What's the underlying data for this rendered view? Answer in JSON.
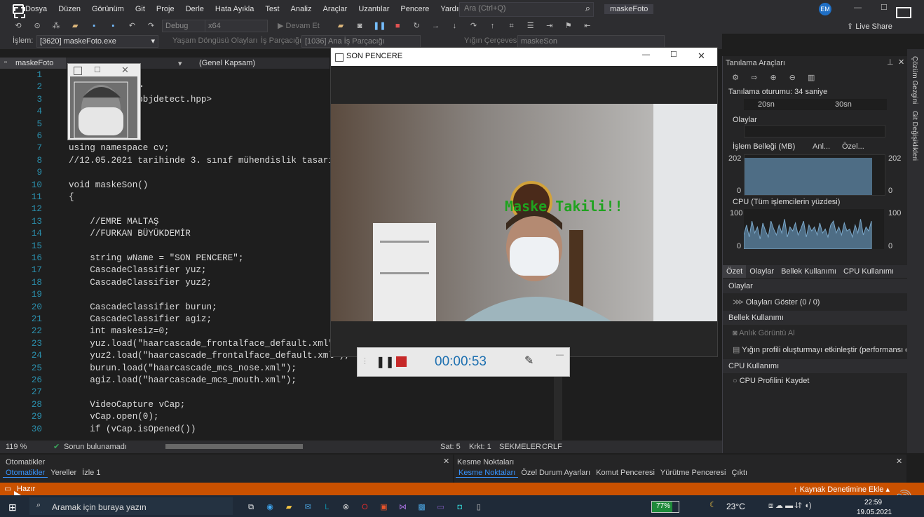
{
  "menubar": {
    "items": [
      "Dosya",
      "Düzen",
      "Görünüm",
      "Git",
      "Proje",
      "Derle",
      "Hata Ayıkla",
      "Test",
      "Analiz",
      "Araçlar",
      "Uzantılar",
      "Pencere",
      "Yardım"
    ],
    "search_placeholder": "Ara (Ctrl+Q)",
    "solution_name": "maskeFoto",
    "user_initials": "EM",
    "live_share": "Live Share"
  },
  "toolbar": {
    "config": "Debug",
    "platform": "x64",
    "continue": "Devam Et"
  },
  "procbar": {
    "process_label": "İşlem:",
    "process_value": "[3620] maskeFoto.exe",
    "lifecycle": "Yaşam Döngüsü Olayları",
    "thread_label": "İş Parçacığı:",
    "thread_value": "[1036] Ana İş Parçacığı",
    "stack_label": "Yığın Çerçevesi:",
    "stack_value": "maskeSon"
  },
  "editor": {
    "tab_name": "maskeFoto",
    "scope": "(Genel Kapsam)",
    "zoom": "119 %",
    "issues": "Sorun bulunamadı",
    "col": "Sat: 5",
    "char": "Krkt: 1",
    "tabs": "SEKMELER",
    "eol": "CRLF",
    "lines": [
      {
        "n": "1",
        "t": "eam>"
      },
      {
        "n": "2",
        "t": "v2/opencv.hpp>"
      },
      {
        "n": "3",
        "t": "v2\\objdetect\\objdetect.hpp>"
      },
      {
        "n": "4",
        "t": ""
      },
      {
        "n": "5",
        "t": ""
      },
      {
        "n": "6",
        "t": "e std;"
      },
      {
        "n": "7",
        "t": "using namespace cv;"
      },
      {
        "n": "8",
        "t": "//12.05.2021 tarihinde 3. sınıf mühendislik tasarım"
      },
      {
        "n": "9",
        "t": ""
      },
      {
        "n": "10",
        "t": "void maskeSon()"
      },
      {
        "n": "11",
        "t": "{"
      },
      {
        "n": "12",
        "t": ""
      },
      {
        "n": "13",
        "t": "    //EMRE MALTAŞ"
      },
      {
        "n": "14",
        "t": "    //FURKAN BÜYÜKDEMİR"
      },
      {
        "n": "15",
        "t": ""
      },
      {
        "n": "16",
        "t": "    string wName = \"SON PENCERE\";"
      },
      {
        "n": "17",
        "t": "    CascadeClassifier yuz;"
      },
      {
        "n": "18",
        "t": "    CascadeClassifier yuz2;"
      },
      {
        "n": "19",
        "t": ""
      },
      {
        "n": "20",
        "t": "    CascadeClassifier burun;"
      },
      {
        "n": "21",
        "t": "    CascadeClassifier agiz;"
      },
      {
        "n": "22",
        "t": "    int maskesiz=0;"
      },
      {
        "n": "23",
        "t": "    yuz.load(\"haarcascade_frontalface_default.xml\");"
      },
      {
        "n": "24",
        "t": "    yuz2.load(\"haarcascade_frontalface_default.xml\");"
      },
      {
        "n": "25",
        "t": "    burun.load(\"haarcascade_mcs_nose.xml\");"
      },
      {
        "n": "26",
        "t": "    agiz.load(\"haarcascade_mcs_mouth.xml\");"
      },
      {
        "n": "27",
        "t": ""
      },
      {
        "n": "28",
        "t": "    VideoCapture vCap;"
      },
      {
        "n": "29",
        "t": "    vCap.open(0);"
      },
      {
        "n": "30",
        "t": "    if (vCap.isOpened())"
      }
    ]
  },
  "son_window": {
    "title": "SON PENCERE",
    "overlay_text": "Maske Takili!!"
  },
  "recorder": {
    "time": "00:00:53"
  },
  "diagnostics": {
    "title": "Tanılama Araçları",
    "session": "Tanılama oturumu: 34 saniye",
    "tick1": "20sn",
    "tick2": "30sn",
    "events_header": "Olaylar",
    "memory_header": "İşlem Belleği (MB)",
    "legend_snapshot": "Anl...",
    "legend_private": "Özel...",
    "mem_max": "202",
    "mem_min": "0",
    "cpu_header": "CPU (Tüm işlemcilerin yüzdesi)",
    "cpu_max": "100",
    "cpu_min": "0",
    "tabs": [
      "Özet",
      "Olaylar",
      "Bellek Kullanımı",
      "CPU Kullanımı"
    ],
    "sec_events": "Olaylar",
    "show_events": "Olayları Göster (0 / 0)",
    "sec_memory": "Bellek Kullanımı",
    "snapshot": "Anlık Görüntü Al",
    "heap_profile": "Yığın profili oluşturmayı etkinleştir (performansı e",
    "sec_cpu": "CPU Kullanımı",
    "cpu_profile": "CPU Profilini Kaydet",
    "mem_fraction": 0.93,
    "cpu_series": [
      0.35,
      0.6,
      0.3,
      0.7,
      0.4,
      0.55,
      0.25,
      0.65,
      0.45,
      0.3,
      0.7,
      0.5,
      0.35,
      0.6,
      0.4,
      0.75,
      0.3,
      0.55,
      0.45,
      0.65,
      0.35,
      0.5,
      0.7,
      0.3,
      0.6,
      0.45,
      0.55,
      0.35,
      0.65,
      0.4,
      0.5,
      0.3,
      0.6,
      0.7,
      0.4,
      0.55,
      0.35,
      0.65,
      0.45,
      0.5,
      0.3,
      0.6,
      0.4,
      0.75,
      0.35,
      0.55,
      0.45,
      0.7
    ]
  },
  "side_tabs": [
    "Çözüm Gezgini",
    "Git Değişiklikleri"
  ],
  "bottom_left": {
    "title": "Otomatikler",
    "tabs": [
      "Otomatikler",
      "Yereller",
      "İzle 1"
    ]
  },
  "bottom_right": {
    "title": "Kesme Noktaları",
    "tabs": [
      "Kesme Noktaları",
      "Özel Durum Ayarları",
      "Komut Penceresi",
      "Yürütme Penceresi",
      "Çıktı"
    ]
  },
  "statusbar": {
    "ready": "Hazır",
    "source_control": "Kaynak Denetimine Ekle"
  },
  "taskbar": {
    "search_placeholder": "Aramak için buraya yazın",
    "battery": "77%",
    "temp": "23°C",
    "time": "22:59",
    "date": "19.05.2021"
  },
  "colors": {
    "accent": "#3794ff",
    "statusbar": "#ca5100",
    "overlay_green": "#1fa31f"
  }
}
